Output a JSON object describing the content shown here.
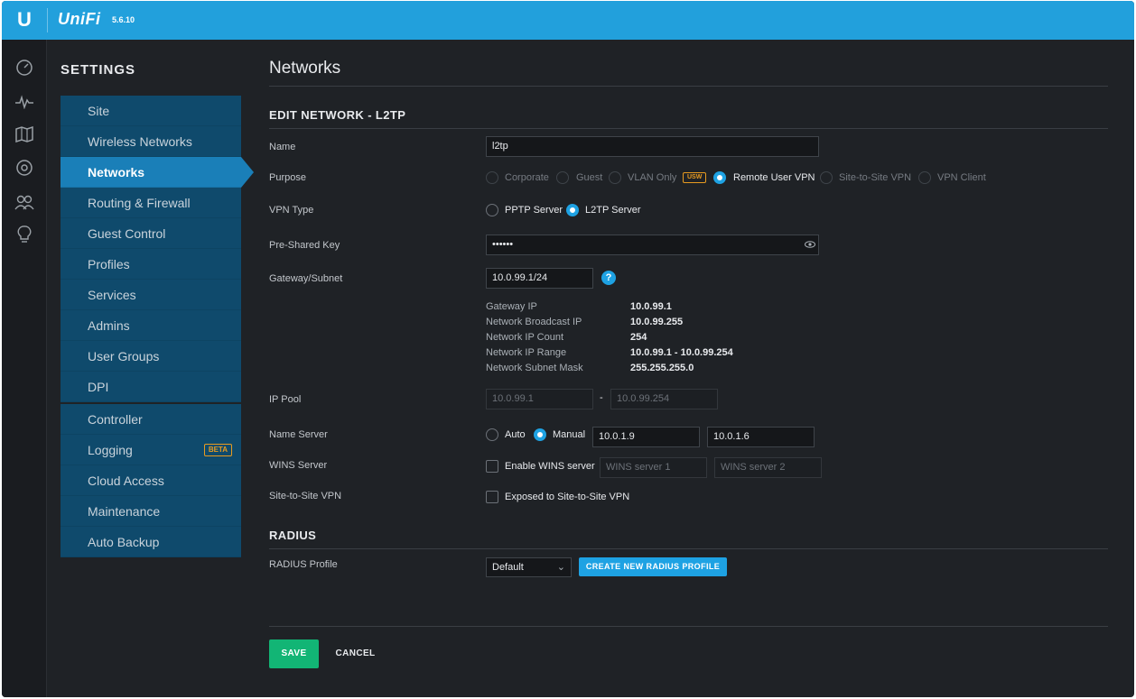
{
  "topbar": {
    "logo": "U",
    "brand": "UniFi",
    "version": "5.6.10"
  },
  "iconbar": [
    "dashboard-icon",
    "statistics-icon",
    "map-icon",
    "devices-icon",
    "clients-icon",
    "insights-icon"
  ],
  "sidebar": {
    "title": "SETTINGS",
    "group1": [
      "Site",
      "Wireless Networks",
      "Networks",
      "Routing & Firewall",
      "Guest Control",
      "Profiles",
      "Services",
      "Admins",
      "User Groups",
      "DPI"
    ],
    "group2": [
      "Controller",
      "Logging",
      "Cloud Access",
      "Maintenance",
      "Auto Backup"
    ],
    "active": "Networks",
    "logging_badge": "BETA"
  },
  "main": {
    "title": "Networks",
    "section": "EDIT NETWORK - L2TP",
    "name_label": "Name",
    "name_value": "l2tp",
    "purpose_label": "Purpose",
    "purpose_options": [
      "Corporate",
      "Guest",
      "VLAN Only",
      "Remote User VPN",
      "Site-to-Site VPN",
      "VPN Client"
    ],
    "purpose_selected": "Remote User VPN",
    "usw_badge": "USW",
    "vpn_type_label": "VPN Type",
    "vpn_type_options": [
      "PPTP Server",
      "L2TP Server"
    ],
    "vpn_type_selected": "L2TP Server",
    "psk_label": "Pre-Shared Key",
    "psk_value": "••••••",
    "gateway_label": "Gateway/Subnet",
    "gateway_value": "10.0.99.1/24",
    "help": "?",
    "info": [
      {
        "k": "Gateway IP",
        "v": "10.0.99.1"
      },
      {
        "k": "Network Broadcast IP",
        "v": "10.0.99.255"
      },
      {
        "k": "Network IP Count",
        "v": "254"
      },
      {
        "k": "Network IP Range",
        "v": "10.0.99.1 - 10.0.99.254"
      },
      {
        "k": "Network Subnet Mask",
        "v": "255.255.255.0"
      }
    ],
    "ip_pool_label": "IP Pool",
    "ip_pool_start": "10.0.99.1",
    "ip_pool_dash": "-",
    "ip_pool_end": "10.0.99.254",
    "name_server_label": "Name Server",
    "ns_auto": "Auto",
    "ns_manual": "Manual",
    "ns1": "10.0.1.9",
    "ns2": "10.0.1.6",
    "wins_label": "WINS Server",
    "wins_enable": "Enable WINS server",
    "wins1_placeholder": "WINS server 1",
    "wins2_placeholder": "WINS server 2",
    "s2s_label": "Site-to-Site VPN",
    "s2s_option": "Exposed to Site-to-Site VPN",
    "radius_section": "RADIUS",
    "radius_profile_label": "RADIUS Profile",
    "radius_profile_value": "Default",
    "create_radius": "CREATE NEW RADIUS PROFILE",
    "save": "SAVE",
    "cancel": "CANCEL"
  }
}
